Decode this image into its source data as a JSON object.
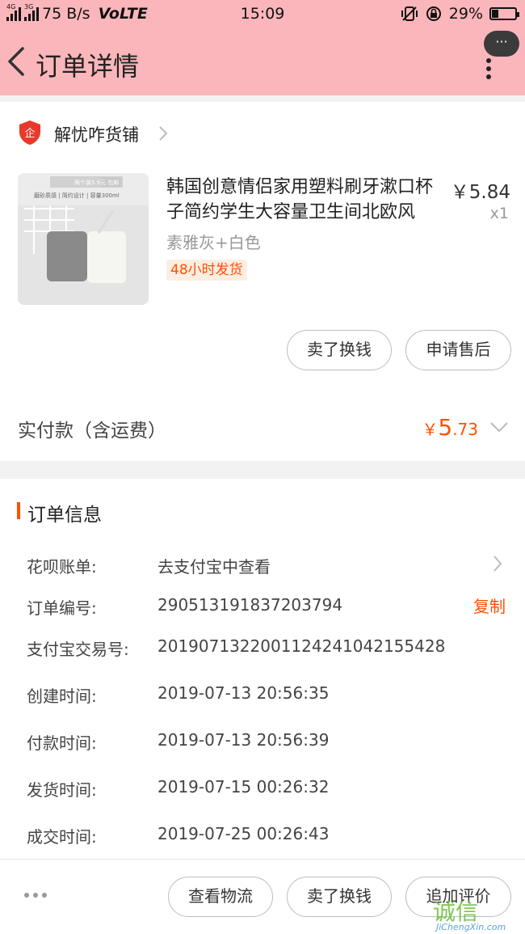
{
  "status_bar": {
    "network_1": "4G",
    "network_2": "3G",
    "speed": "75 B/s",
    "volte": "VoLTE",
    "time": "15:09",
    "battery": "29%",
    "battery_level": 0.29
  },
  "header": {
    "title": "订单详情",
    "more_bubble": "···"
  },
  "shop": {
    "icon_label": "企",
    "name": "解忧咋货铺"
  },
  "product": {
    "title": "韩国创意情侣家用塑料刷牙漱口杯子简约学生大容量卫生间北欧风",
    "price": "￥5.84",
    "qty": "x1",
    "sku": "素雅灰+白色",
    "tag": "48小时发货",
    "image_banner": "两个装5.9元 包邮",
    "image_caption": "磨砂质感 | 简约设计 | 容量300ml"
  },
  "actions": {
    "sell_label": "卖了换钱",
    "after_sale_label": "申请售后"
  },
  "payment": {
    "label": "实付款（含运费）",
    "currency": "￥",
    "int": "5",
    "dec": ".73"
  },
  "order_info": {
    "title": "订单信息",
    "copy_label": "复制",
    "rows": [
      {
        "label": "花呗账单:",
        "value": "去支付宝中查看"
      },
      {
        "label": "订单编号:",
        "value": "290513191837203794"
      },
      {
        "label": "支付宝交易号:",
        "value": "2019071322001124241042155428"
      },
      {
        "label": "创建时间:",
        "value": "2019-07-13 20:56:35"
      },
      {
        "label": "付款时间:",
        "value": "2019-07-13 20:56:39"
      },
      {
        "label": "发货时间:",
        "value": "2019-07-15 00:26:32"
      },
      {
        "label": "成交时间:",
        "value": "2019-07-25 00:26:43"
      }
    ]
  },
  "bottom_bar": {
    "logistics_label": "查看物流",
    "sell_label": "卖了换钱",
    "review_label": "追加评价"
  },
  "watermark": {
    "cn": "诚信",
    "en": "JiChengXin.com"
  },
  "colors": {
    "header_bg": "#fbb6bb",
    "accent": "#ff5000"
  }
}
